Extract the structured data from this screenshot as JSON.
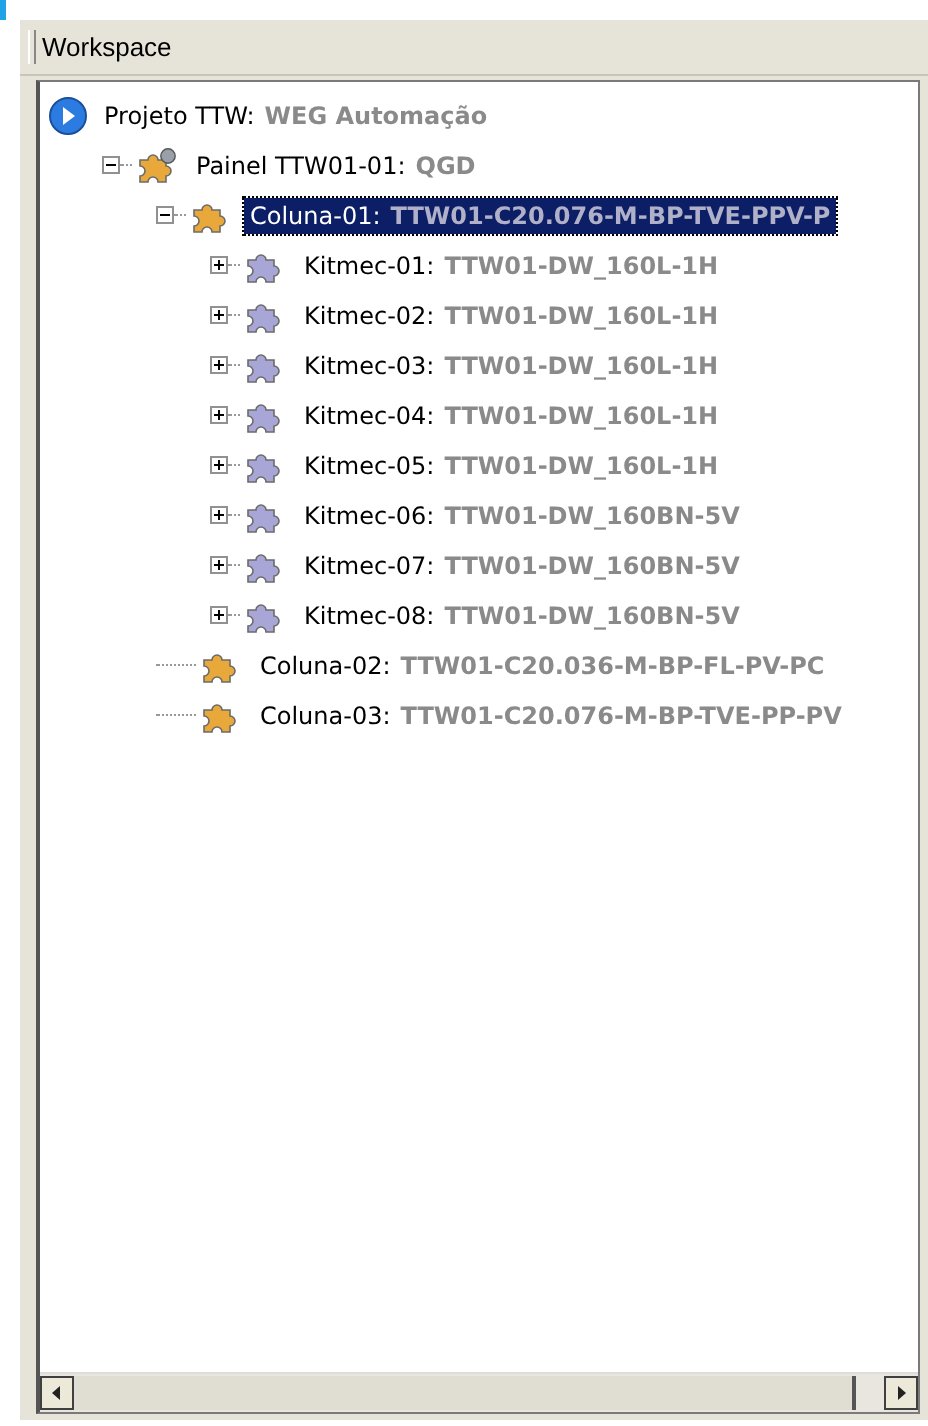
{
  "panel": {
    "title": "Workspace"
  },
  "tree": [
    {
      "kind": "project",
      "label": "Projeto TTW:",
      "value": "WEG Automação",
      "selected": false,
      "children": [
        {
          "kind": "panel",
          "label": "Painel TTW01-01:",
          "value": "QGD",
          "selected": false,
          "expanded": true,
          "children": [
            {
              "kind": "column",
              "label": "Coluna-01:",
              "value": "TTW01-C20.076-M-BP-TVE-PPV-P",
              "selected": true,
              "expanded": true,
              "children": [
                {
                  "kind": "kit",
                  "label": "Kitmec-01:",
                  "value": "TTW01-DW_160L-1H",
                  "selected": false,
                  "expanded": false
                },
                {
                  "kind": "kit",
                  "label": "Kitmec-02:",
                  "value": "TTW01-DW_160L-1H",
                  "selected": false,
                  "expanded": false
                },
                {
                  "kind": "kit",
                  "label": "Kitmec-03:",
                  "value": "TTW01-DW_160L-1H",
                  "selected": false,
                  "expanded": false
                },
                {
                  "kind": "kit",
                  "label": "Kitmec-04:",
                  "value": "TTW01-DW_160L-1H",
                  "selected": false,
                  "expanded": false
                },
                {
                  "kind": "kit",
                  "label": "Kitmec-05:",
                  "value": "TTW01-DW_160L-1H",
                  "selected": false,
                  "expanded": false
                },
                {
                  "kind": "kit",
                  "label": "Kitmec-06:",
                  "value": "TTW01-DW_160BN-5V",
                  "selected": false,
                  "expanded": false
                },
                {
                  "kind": "kit",
                  "label": "Kitmec-07:",
                  "value": "TTW01-DW_160BN-5V",
                  "selected": false,
                  "expanded": false
                },
                {
                  "kind": "kit",
                  "label": "Kitmec-08:",
                  "value": "TTW01-DW_160BN-5V",
                  "selected": false,
                  "expanded": false
                }
              ]
            },
            {
              "kind": "column",
              "label": "Coluna-02:",
              "value": "TTW01-C20.036-M-BP-FL-PV-PC",
              "selected": false
            },
            {
              "kind": "column",
              "label": "Coluna-03:",
              "value": "TTW01-C20.076-M-BP-TVE-PP-PV",
              "selected": false
            }
          ]
        }
      ]
    }
  ]
}
